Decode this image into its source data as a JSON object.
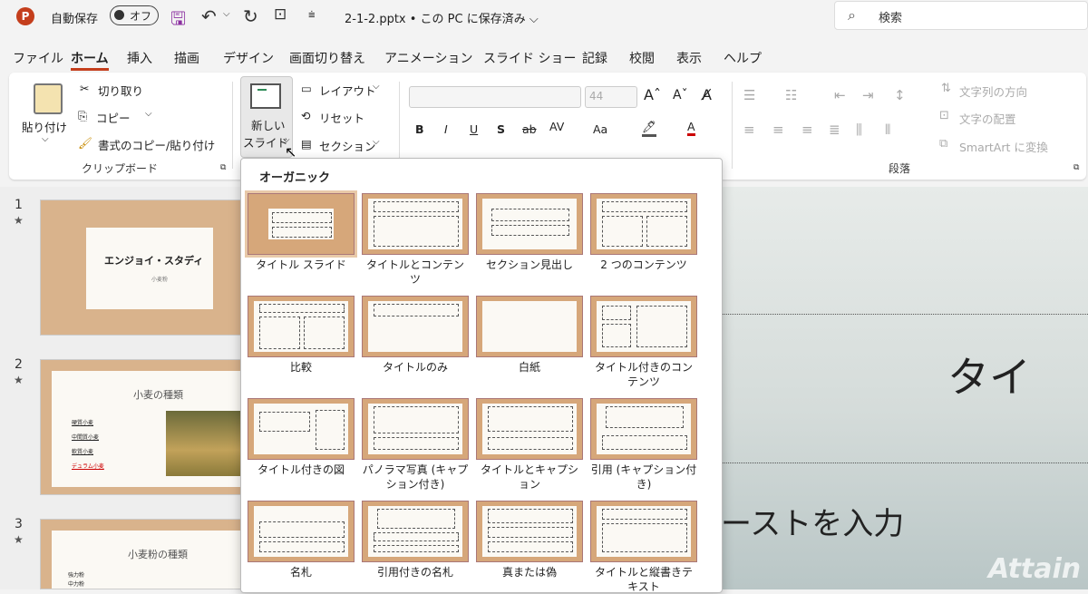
{
  "titlebar": {
    "app_logo": "P",
    "autosave_label": "自動保存",
    "autosave_state": "オフ",
    "filename": "2-1-2.pptx • この PC に保存済み ⌵",
    "search_placeholder": "検索"
  },
  "tabs": [
    "ファイル",
    "ホーム",
    "挿入",
    "描画",
    "デザイン",
    "画面切り替え",
    "アニメーション",
    "スライド ショー",
    "記録",
    "校閲",
    "表示",
    "ヘルプ"
  ],
  "ribbon": {
    "paste": "貼り付け",
    "cut": "切り取り",
    "copy": "コピー",
    "format_painter": "書式のコピー/貼り付け",
    "clipboard_group": "クリップボード",
    "new_slide_1": "新しい",
    "new_slide_2": "スライド",
    "layout": "レイアウト",
    "reset": "リセット",
    "section": "セクション",
    "font_size": "44",
    "paragraph_group": "段落",
    "text_direction": "文字列の方向",
    "align_text": "文字の配置",
    "smartart": "SmartArt に変換"
  },
  "thumbnails": [
    {
      "num": "1",
      "star": "★",
      "title": "エンジョイ・スタディ",
      "sub": "小麦粉"
    },
    {
      "num": "2",
      "star": "★",
      "title": "小麦の種類",
      "items": [
        "硬質小麦",
        "中間質小麦",
        "軟質小麦",
        "デュラム小麦"
      ]
    },
    {
      "num": "3",
      "star": "★",
      "title": "小麦粉の種類",
      "items": [
        "強力粉",
        "中力粉"
      ]
    }
  ],
  "canvas": {
    "title_partial": "タイ",
    "body_partial": "ーストを入力",
    "watermark": "Attain"
  },
  "gallery": {
    "header": "オーガニック",
    "layouts": [
      "タイトル スライド",
      "タイトルとコンテンツ",
      "セクション見出し",
      "2 つのコンテンツ",
      "比較",
      "タイトルのみ",
      "白紙",
      "タイトル付きのコンテンツ",
      "タイトル付きの図",
      "パノラマ写真 (キャプション付き)",
      "タイトルとキャプション",
      "引用 (キャプション付き)",
      "名札",
      "引用付きの名札",
      "真または偽",
      "タイトルと縦書きテキスト"
    ]
  }
}
